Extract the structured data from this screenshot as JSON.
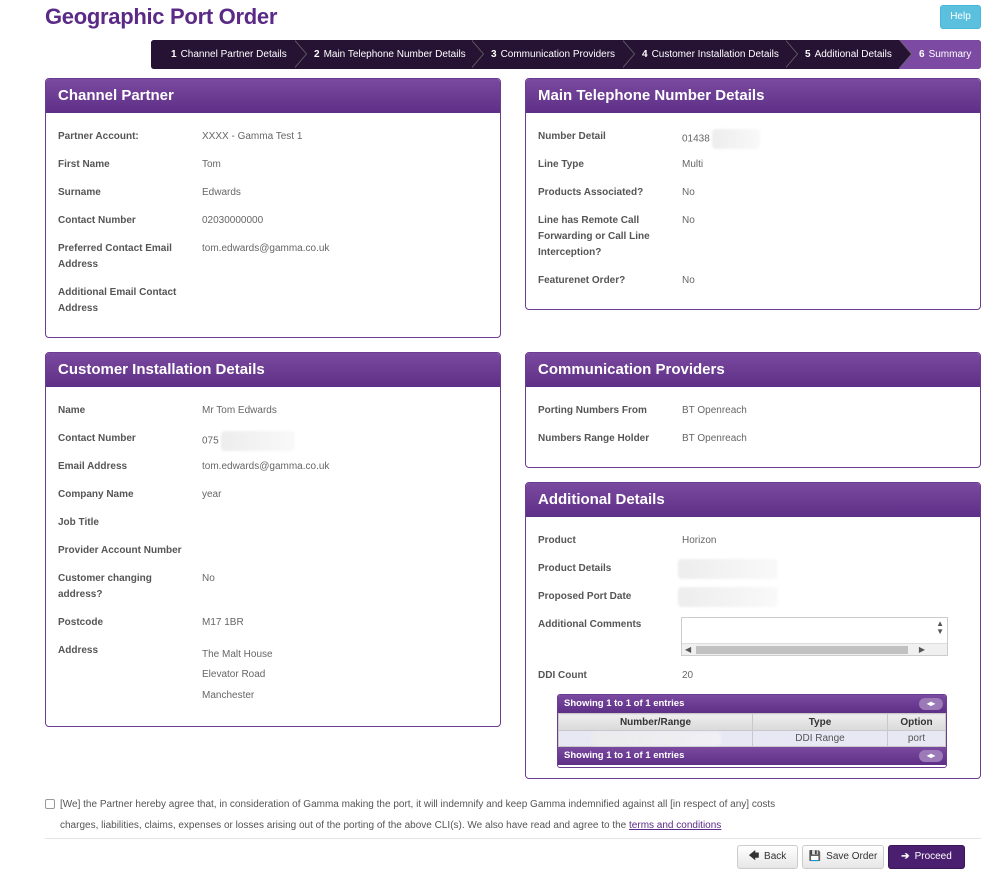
{
  "page": {
    "title": "Geographic Port Order",
    "help_label": "Help"
  },
  "steps": [
    {
      "num": "1",
      "label": "Channel Partner Details"
    },
    {
      "num": "2",
      "label": "Main Telephone Number Details"
    },
    {
      "num": "3",
      "label": "Communication Providers"
    },
    {
      "num": "4",
      "label": "Customer Installation Details"
    },
    {
      "num": "5",
      "label": "Additional Details"
    },
    {
      "num": "6",
      "label": "Summary"
    }
  ],
  "channel_partner": {
    "title": "Channel Partner",
    "rows": [
      {
        "label": "Partner Account:",
        "value": "XXXX - Gamma Test 1"
      },
      {
        "label": "First Name",
        "value": "Tom"
      },
      {
        "label": "Surname",
        "value": "Edwards"
      },
      {
        "label": "Contact Number",
        "value": "02030000000"
      },
      {
        "label": "Preferred Contact Email Address",
        "value": "tom.edwards@gamma.co.uk"
      },
      {
        "label": "Additional Email Contact Address",
        "value": ""
      }
    ]
  },
  "main_number": {
    "title": "Main Telephone Number Details",
    "rows": [
      {
        "label": "Number Detail",
        "value": "01438"
      },
      {
        "label": "Line Type",
        "value": "Multi"
      },
      {
        "label": "Products Associated?",
        "value": "No"
      },
      {
        "label": "Line has Remote Call Forwarding or Call Line Interception?",
        "value": "No"
      },
      {
        "label": "Featurenet Order?",
        "value": "No"
      }
    ]
  },
  "customer_install": {
    "title": "Customer Installation Details",
    "rows": [
      {
        "label": "Name",
        "value": "Mr Tom Edwards"
      },
      {
        "label": "Contact Number",
        "value": "075"
      },
      {
        "label": "Email Address",
        "value": "tom.edwards@gamma.co.uk"
      },
      {
        "label": "Company Name",
        "value": "year"
      },
      {
        "label": "Job Title",
        "value": ""
      },
      {
        "label": "Provider Account Number",
        "value": ""
      },
      {
        "label": "Customer changing address?",
        "value": "No"
      },
      {
        "label": "Postcode",
        "value": "M17 1BR"
      },
      {
        "label": "Address",
        "value": ""
      }
    ],
    "address_lines": [
      "The Malt House",
      "Elevator Road",
      "Manchester"
    ]
  },
  "comm_providers": {
    "title": "Communication Providers",
    "rows": [
      {
        "label": "Porting Numbers From",
        "value": "BT Openreach"
      },
      {
        "label": "Numbers Range Holder",
        "value": "BT Openreach"
      }
    ]
  },
  "additional": {
    "title": "Additional Details",
    "rows": [
      {
        "label": "Product",
        "value": "Horizon"
      },
      {
        "label": "Product Details",
        "value": ""
      },
      {
        "label": "Proposed Port Date",
        "value": ""
      },
      {
        "label": "Additional Comments",
        "value": ""
      },
      {
        "label": "DDI Count",
        "value": "20"
      }
    ]
  },
  "ddi_table": {
    "info": "Showing 1 to 1 of 1 entries",
    "columns": [
      "Number/Range",
      "Type",
      "Option"
    ],
    "rows": [
      {
        "number": "",
        "type": "DDI Range",
        "option": "port"
      }
    ]
  },
  "agreement": {
    "text": "[We] the Partner hereby agree that, in consideration of Gamma making the port, it will indemnify and keep Gamma indemnified against all [in respect of any] costs charges, liabilities, claims, expenses or losses arising out of the porting of the above CLI(s). We also have read and agree to the",
    "link": "terms and conditions"
  },
  "buttons": {
    "back": "Back",
    "save": "Save Order",
    "proceed": "Proceed"
  },
  "colors": {
    "brand": "#5b2a86",
    "panel_header": "#6b3d91",
    "help": "#5bc0de"
  }
}
